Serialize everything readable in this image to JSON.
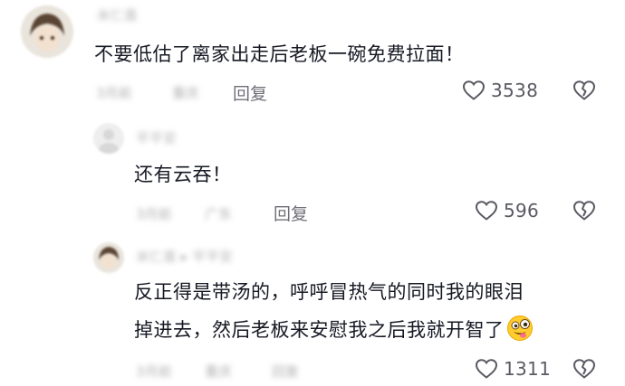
{
  "comments": [
    {
      "username": "米仁喜",
      "text": "不要低估了离家出走后老板一碗免费拉面！",
      "meta_date": "3月前",
      "meta_location": "重庆",
      "reply_label": "回复",
      "likes": "3538"
    },
    {
      "username": "平平安",
      "text": "还有云吞！",
      "meta_date": "3月前",
      "meta_location": "广东",
      "reply_label": "回复",
      "likes": "596"
    },
    {
      "username": "米仁喜 ▸ 平平安",
      "text_line1": "反正得是带汤的，呼呼冒热气的同时我的眼泪",
      "text_line2": "掉进去，然后老板来安慰我之后我就开智了",
      "meta_date": "3月前",
      "meta_location": "重庆",
      "reply_label": "回复",
      "likes": "1311"
    }
  ],
  "icons": {
    "like": "heart-outline-icon",
    "dislike": "broken-heart-icon",
    "emoji": "zany-face-emoji"
  },
  "colors": {
    "text": "#161823",
    "secondary": "#6f6f78",
    "muted": "#b0b0b0"
  }
}
